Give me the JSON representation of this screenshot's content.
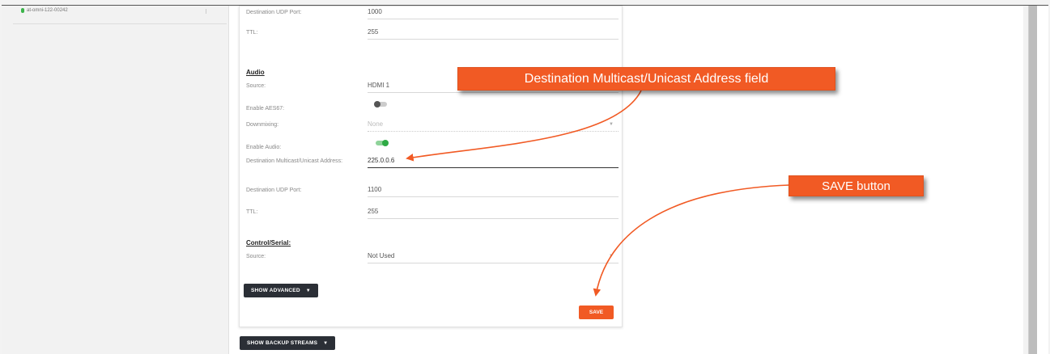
{
  "sidebar": {
    "device_name": "at-omni-122-00242"
  },
  "form": {
    "top_rows": [
      {
        "label": "Destination UDP Port:",
        "value": "1000"
      },
      {
        "label": "TTL:",
        "value": "255"
      }
    ],
    "audio": {
      "heading": "Audio",
      "source_label": "Source:",
      "source_value": "HDMI 1",
      "aes67_label": "Enable AES67:",
      "aes67_on": false,
      "downmix_label": "Downmixing:",
      "downmix_value": "None",
      "enable_audio_label": "Enable Audio:",
      "enable_audio_on": true,
      "dest_addr_label": "Destination Multicast/Unicast Address:",
      "dest_addr_value": "225.0.0.6",
      "udp_label": "Destination UDP Port:",
      "udp_value": "1100",
      "ttl_label": "TTL:",
      "ttl_value": "255"
    },
    "control": {
      "heading": "Control/Serial:",
      "source_label": "Source:",
      "source_value": "Not Used"
    },
    "show_advanced": "SHOW ADVANCED",
    "save": "SAVE",
    "show_backup": "SHOW BACKUP STREAMS"
  },
  "callouts": {
    "address": "Destination Multicast/Unicast Address field",
    "save": "SAVE button"
  },
  "colors": {
    "accent": "#f15a24",
    "toggle_on": "#2eaa45",
    "dark_button": "#2b2f36"
  }
}
